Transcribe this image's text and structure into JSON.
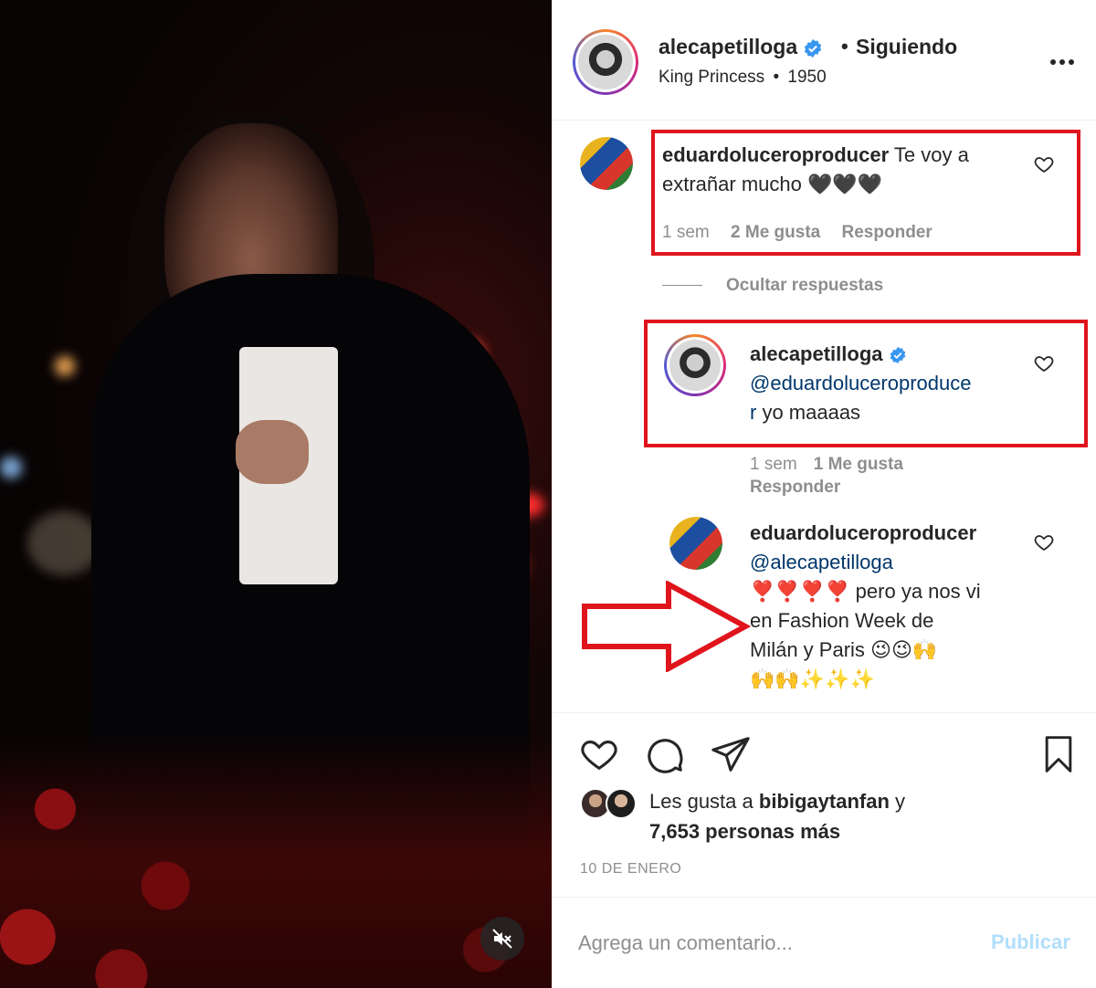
{
  "post": {
    "username": "alecapetilloga",
    "dot": "•",
    "follow_status": "Siguiendo",
    "audio": "King Princess",
    "audio_separator": "•",
    "audio_track": "1950"
  },
  "comments": [
    {
      "username": "eduardoluceroproducer",
      "text": " Te voy a",
      "text_line2": "extrañar mucho 🖤🖤🖤",
      "time": "1 sem",
      "likes": "2 Me gusta",
      "reply": "Responder"
    }
  ],
  "hide_replies_label": "Ocultar respuestas",
  "replies": [
    {
      "username": "alecapetilloga",
      "mention_line1": "@eduardoluceroproduce",
      "mention_line2": "r",
      "text": " yo maaaas",
      "time": "1 sem",
      "likes": "1 Me gusta",
      "reply": "Responder"
    },
    {
      "username": "eduardoluceroproducer",
      "mention": "@alecapetilloga",
      "line1": "❣️❣️❣️❣️ pero ya nos vi",
      "line2": "en Fashion Week de",
      "line3": "Milán y Paris 😉😉🙌",
      "line4": "🙌🙌✨✨✨"
    }
  ],
  "likes": {
    "prefix": "Les gusta a ",
    "user": "bibigaytanfan",
    "suffix": " y",
    "others": "7,653 personas más"
  },
  "date": "10 DE ENERO",
  "comment_box": {
    "placeholder": "Agrega un comentario...",
    "publish_label": "Publicar"
  },
  "icons": {
    "verified": "verified-badge-icon",
    "more": "more-options-icon",
    "heart": "heart-icon",
    "comment": "comment-icon",
    "share": "share-icon",
    "bookmark": "bookmark-icon",
    "mute": "muted-speaker-icon"
  },
  "colors": {
    "highlight_box": "#e0141c",
    "verified_blue": "#3897f0",
    "mention_blue": "#00376b",
    "publish_disabled": "#b2dffc"
  }
}
